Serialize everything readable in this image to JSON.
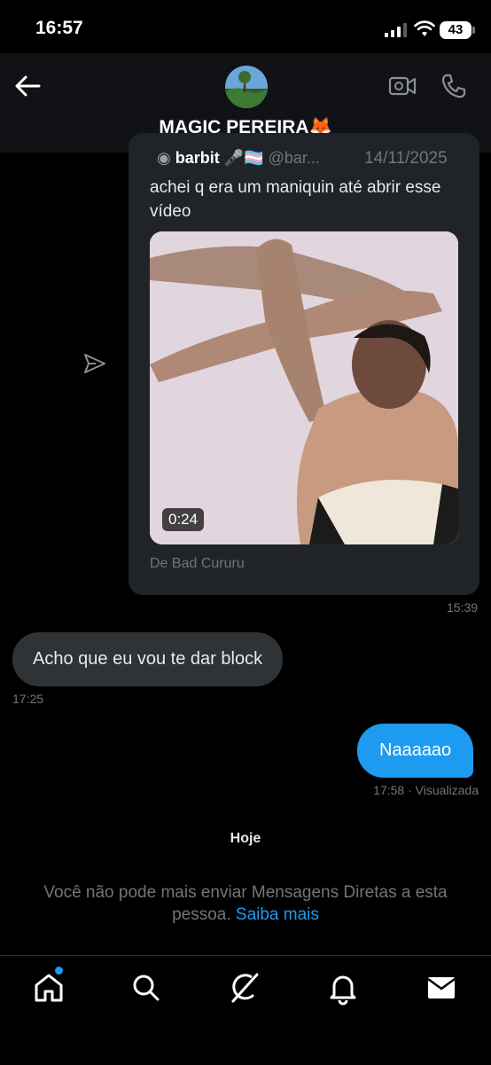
{
  "status_bar": {
    "time": "16:57",
    "battery": "43"
  },
  "header": {
    "title": "MAGIC PEREIRA🦊"
  },
  "shared_post": {
    "author_name": "barbit 🎤🏳️‍⚧️",
    "author_handle": "@bar...",
    "date": "14/11/2025",
    "text": "achei q era um maniquin até abrir esse vídeo",
    "video_duration": "0:24",
    "footer": "De Bad Cururu",
    "timestamp": "15:39"
  },
  "messages": [
    {
      "text": "Acho que eu vou te dar block",
      "timestamp": "17:25"
    },
    {
      "text": "Naaaaao",
      "timestamp": "17:58 · Visualizada"
    }
  ],
  "divider": "Hoje",
  "notice": {
    "text": "Você não pode mais enviar Mensagens Diretas a esta pessoa.",
    "link": "Saiba mais"
  },
  "icons": [
    "back-arrow-icon",
    "video-call-icon",
    "phone-icon",
    "send-icon",
    "home-icon",
    "search-icon",
    "grok-icon",
    "bell-icon",
    "mail-icon"
  ],
  "colors": {
    "accent": "#1d9bf0",
    "bubble_in": "#2f3336",
    "card": "#202327"
  }
}
